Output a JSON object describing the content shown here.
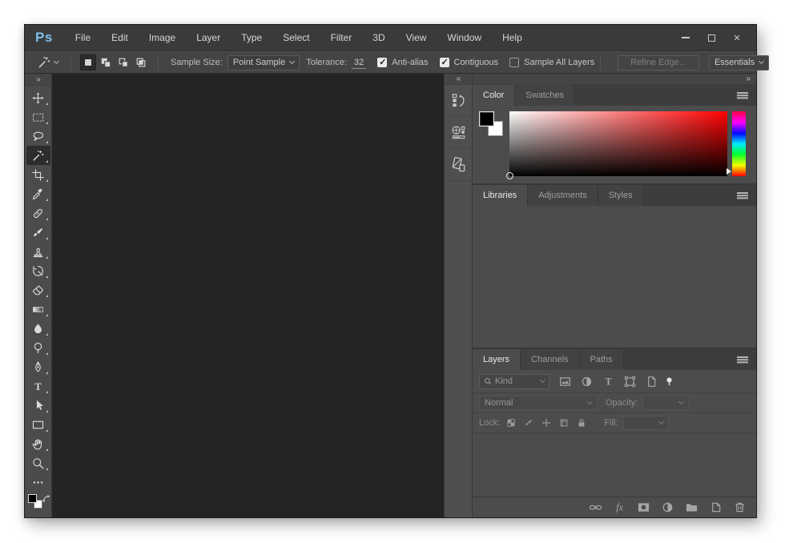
{
  "app": {
    "logo": "Ps"
  },
  "titlebar": {
    "menu": [
      {
        "name": "menu-file",
        "label": "File"
      },
      {
        "name": "menu-edit",
        "label": "Edit"
      },
      {
        "name": "menu-image",
        "label": "Image"
      },
      {
        "name": "menu-layer",
        "label": "Layer"
      },
      {
        "name": "menu-type",
        "label": "Type"
      },
      {
        "name": "menu-select",
        "label": "Select"
      },
      {
        "name": "menu-filter",
        "label": "Filter"
      },
      {
        "name": "menu-3d",
        "label": "3D"
      },
      {
        "name": "menu-view",
        "label": "View"
      },
      {
        "name": "menu-window",
        "label": "Window"
      },
      {
        "name": "menu-help",
        "label": "Help"
      }
    ]
  },
  "options_bar": {
    "selection_modes": [
      {
        "name": "new-selection-button",
        "icon": "mode-new",
        "selected": true
      },
      {
        "name": "add-to-selection-button",
        "icon": "mode-add"
      },
      {
        "name": "subtract-from-selection-button",
        "icon": "mode-subtract"
      },
      {
        "name": "intersect-selection-button",
        "icon": "mode-intersect"
      }
    ],
    "sample_size_label": "Sample Size:",
    "sample_size_value": "Point Sample",
    "tolerance_label": "Tolerance:",
    "tolerance_value": "32",
    "checkboxes": [
      {
        "name": "anti-alias-checkbox",
        "label": "Anti-alias",
        "checked": true
      },
      {
        "name": "contiguous-checkbox",
        "label": "Contiguous",
        "checked": true
      },
      {
        "name": "sample-all-layers-checkbox",
        "label": "Sample All Layers",
        "checked": false
      }
    ],
    "refine_edge_label": "Refine Edge...",
    "workspace_value": "Essentials"
  },
  "toolbar": {
    "collapse_glyph": "»",
    "tools": [
      {
        "name": "move-tool",
        "icon": "move"
      },
      {
        "name": "rectangular-marquee-tool",
        "icon": "marquee"
      },
      {
        "name": "lasso-tool",
        "icon": "lasso"
      },
      {
        "name": "magic-wand-tool",
        "icon": "wand",
        "selected": true
      },
      {
        "name": "crop-tool",
        "icon": "crop"
      },
      {
        "name": "eyedropper-tool",
        "icon": "eyedropper"
      },
      {
        "name": "spot-healing-brush-tool",
        "icon": "healing"
      },
      {
        "name": "brush-tool",
        "icon": "brush"
      },
      {
        "name": "clone-stamp-tool",
        "icon": "stamp"
      },
      {
        "name": "history-brush-tool",
        "icon": "history-brush"
      },
      {
        "name": "eraser-tool",
        "icon": "eraser"
      },
      {
        "name": "gradient-tool",
        "icon": "gradient"
      },
      {
        "name": "blur-tool",
        "icon": "blur"
      },
      {
        "name": "dodge-tool",
        "icon": "dodge"
      },
      {
        "name": "pen-tool",
        "icon": "pen"
      },
      {
        "name": "type-tool",
        "icon": "type"
      },
      {
        "name": "path-selection-tool",
        "icon": "path-select"
      },
      {
        "name": "rectangle-tool",
        "icon": "rectangle"
      },
      {
        "name": "hand-tool",
        "icon": "hand"
      },
      {
        "name": "zoom-tool",
        "icon": "zoom"
      },
      {
        "name": "edit-toolbar-button",
        "icon": "more",
        "flyout": false
      }
    ]
  },
  "dock_strip": {
    "collapse_glyph": "«",
    "buttons": [
      {
        "name": "history-panel-button",
        "icon": "history-panel"
      },
      {
        "name": "export-panel-button",
        "icon": "sphere-panel"
      },
      {
        "name": "device-preview-panel-button",
        "icon": "device-panel"
      }
    ]
  },
  "right_dock": {
    "collapse_glyph": "»"
  },
  "color_panel": {
    "tabs": [
      {
        "name": "tab-color",
        "label": "Color",
        "active": true
      },
      {
        "name": "tab-swatches",
        "label": "Swatches"
      }
    ],
    "foreground_color": "#000000",
    "background_color": "#ffffff"
  },
  "libraries_panel": {
    "tabs": [
      {
        "name": "tab-libraries",
        "label": "Libraries",
        "active": true
      },
      {
        "name": "tab-adjustments",
        "label": "Adjustments"
      },
      {
        "name": "tab-styles",
        "label": "Styles"
      }
    ]
  },
  "layers_panel": {
    "tabs": [
      {
        "name": "tab-layers",
        "label": "Layers",
        "active": true
      },
      {
        "name": "tab-channels",
        "label": "Channels"
      },
      {
        "name": "tab-paths",
        "label": "Paths"
      }
    ],
    "filter_label": "Kind",
    "filter_icons": [
      {
        "name": "filter-pixel-layers-button",
        "icon": "f-image"
      },
      {
        "name": "filter-adjustment-layers-button",
        "icon": "f-adjust"
      },
      {
        "name": "filter-type-layers-button",
        "icon": "f-type"
      },
      {
        "name": "filter-shape-layers-button",
        "icon": "f-shape"
      },
      {
        "name": "filter-smart-objects-button",
        "icon": "f-smart"
      }
    ],
    "blend_mode_value": "Normal",
    "opacity_label": "Opacity:",
    "lock_label": "Lock:",
    "lock_icons": [
      {
        "name": "lock-transparency-button",
        "icon": "l-checker"
      },
      {
        "name": "lock-pixels-button",
        "icon": "l-brush"
      },
      {
        "name": "lock-position-button",
        "icon": "l-move"
      },
      {
        "name": "lock-artboard-button",
        "icon": "l-frame"
      },
      {
        "name": "lock-all-button",
        "icon": "l-lock"
      }
    ],
    "fill_label": "Fill:",
    "footer_icons": [
      {
        "name": "link-layers-button",
        "icon": "ft-link"
      },
      {
        "name": "layer-style-button",
        "icon": "ft-fx"
      },
      {
        "name": "add-layer-mask-button",
        "icon": "ft-mask"
      },
      {
        "name": "adjustment-layer-button",
        "icon": "ft-adjust"
      },
      {
        "name": "new-group-button",
        "icon": "ft-folder"
      },
      {
        "name": "new-layer-button",
        "icon": "ft-newlayer"
      },
      {
        "name": "delete-layer-button",
        "icon": "ft-trash"
      }
    ]
  },
  "colors": {
    "titlebar": "#3a3a3a",
    "panel": "#4c4c4c",
    "canvas": "#242424",
    "logo_blue": "#7cc0ea",
    "gradient_hue": "#ff0000"
  }
}
